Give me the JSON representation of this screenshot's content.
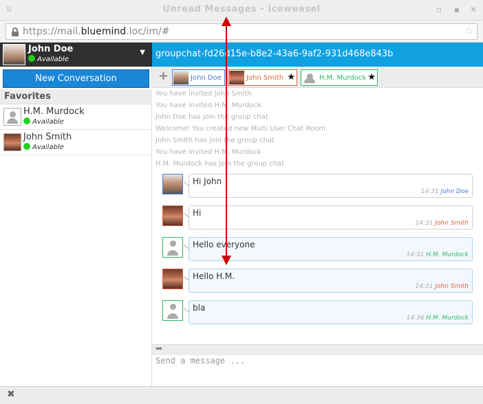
{
  "window": {
    "title": "Unread Messages - Iceweasel",
    "menu_glyph": "⠿",
    "buttons": {
      "minimize": "▫",
      "maximize": "▪",
      "close": "✕"
    }
  },
  "browser": {
    "url_prefix": "https://mail.",
    "url_host": "bluemind",
    "url_suffix": ".loc/im/#",
    "bookmark_glyph": "☆"
  },
  "user": {
    "name": "John Doe",
    "status": "Available",
    "dropdown_glyph": "▼"
  },
  "sidebar": {
    "new_conversation": "New Conversation",
    "favorites_heading": "Favorites",
    "contacts": [
      {
        "name": "H.M. Murdock",
        "status": "Available"
      },
      {
        "name": "John Smith",
        "status": "Available"
      }
    ]
  },
  "room": {
    "name": "groupchat-fd26d15e-b8e2-43a6-9af2-931d468e843b",
    "add_glyph": "+",
    "participants": [
      {
        "name": "John Doe",
        "color": "#4b7bd9",
        "star": ""
      },
      {
        "name": "John Smith",
        "color": "#d9633f",
        "star": "★"
      },
      {
        "name": "H.M. Murdock",
        "color": "#2fb86a",
        "star": "★"
      }
    ]
  },
  "system_messages": [
    "You have invited John Smith",
    "You have invited H.M. Murdock",
    "John Doe has join the group chat",
    "Welcome! You created new Multi User Chat Room.",
    "John Smith has join the group chat",
    "You have invited H.M. Murdock",
    "H.M. Murdock has join the group chat"
  ],
  "messages": [
    {
      "text": "Hi John",
      "time": "14:31",
      "author": "John Doe",
      "color": "#4b7bd9"
    },
    {
      "text": "Hi",
      "time": "14:31",
      "author": "John Smith",
      "color": "#d9633f"
    },
    {
      "text": "Hello everyone",
      "time": "14:31",
      "author": "H.M. Murdock",
      "color": "#2fb86a"
    },
    {
      "text": "Hello H.M.",
      "time": "14:31",
      "author": "John Smith",
      "color": "#d9633f"
    },
    {
      "text": "bla",
      "time": "14:36",
      "author": "H.M. Murdock",
      "color": "#2fb86a"
    }
  ],
  "composer": {
    "send_glyph": "➦",
    "placeholder": "Send a message ..."
  },
  "statusbar": {
    "close_glyph": "✖"
  },
  "colors": {
    "accent": "#11a0e0",
    "button": "#1a86d8",
    "online": "#22d11e",
    "annotation": "#cc0000"
  }
}
